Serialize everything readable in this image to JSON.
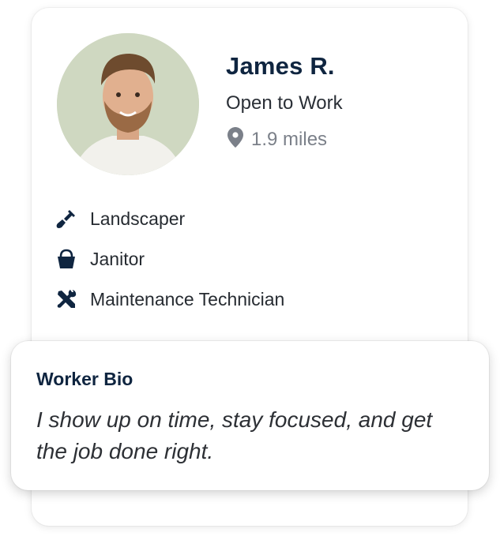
{
  "profile": {
    "name": "James R.",
    "status": "Open to Work",
    "distance": "1.9 miles",
    "avatar_bg": "#cfd8c1"
  },
  "skills": [
    {
      "label": "Landscaper",
      "icon": "shovel-icon"
    },
    {
      "label": "Janitor",
      "icon": "bucket-icon"
    },
    {
      "label": "Maintenance Technician",
      "icon": "tools-icon"
    }
  ],
  "bio": {
    "title": "Worker Bio",
    "text": "I show up on time, stay focused, and get the job done right."
  },
  "colors": {
    "name": "#0f2540",
    "icon": "#0f2540",
    "muted": "#7b8089"
  }
}
